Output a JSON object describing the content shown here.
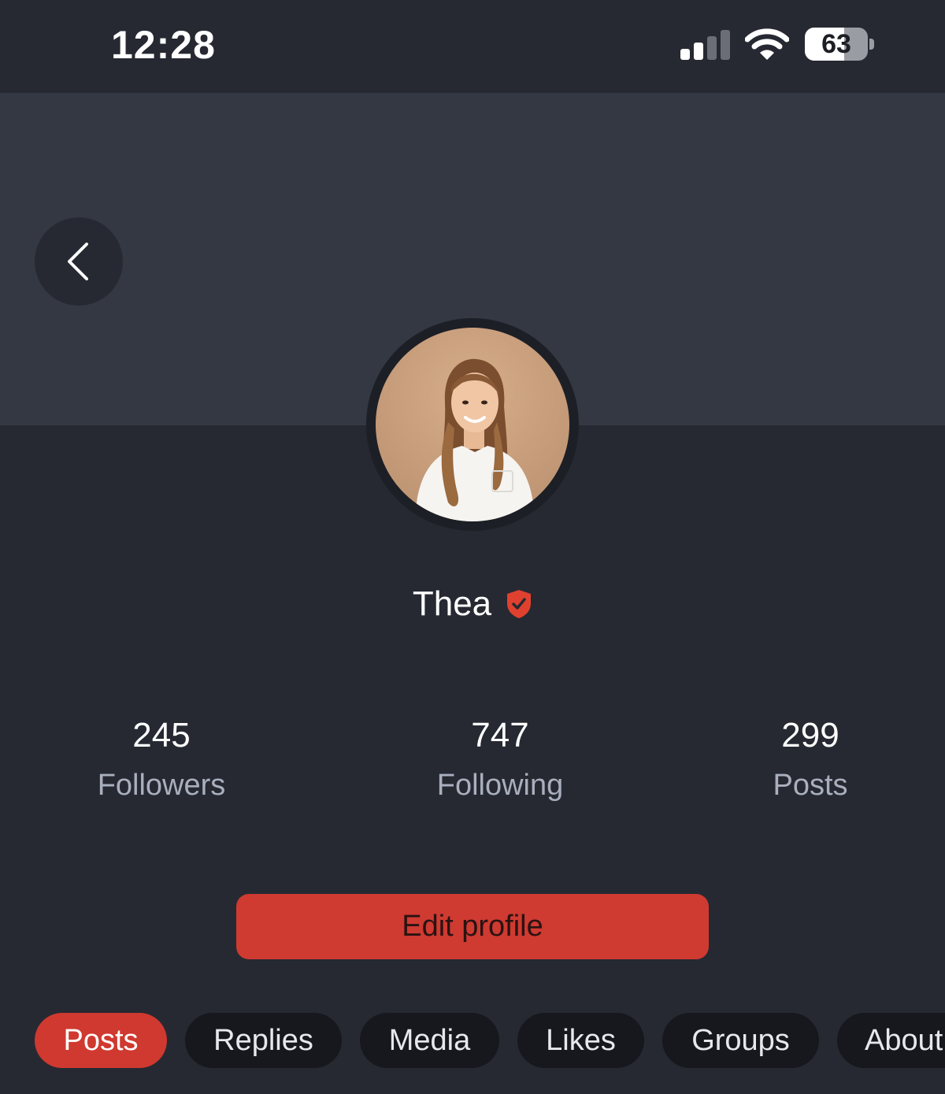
{
  "status_bar": {
    "time": "12:28",
    "battery_level": "63",
    "battery_fraction": 0.63,
    "signal_bars_active": 2,
    "signal_bars_total": 4
  },
  "colors": {
    "background": "#262932",
    "cover": "#343842",
    "accent": "#cf3a31",
    "muted_text": "#a9afbd",
    "tab_background": "#17181d"
  },
  "profile": {
    "name": "Thea",
    "verified": true,
    "verified_icon": "verified-shield-icon"
  },
  "stats": [
    {
      "value": "245",
      "label": "Followers"
    },
    {
      "value": "747",
      "label": "Following"
    },
    {
      "value": "299",
      "label": "Posts"
    }
  ],
  "actions": {
    "edit_profile_label": "Edit profile"
  },
  "tabs": [
    {
      "label": "Posts",
      "active": true
    },
    {
      "label": "Replies",
      "active": false
    },
    {
      "label": "Media",
      "active": false
    },
    {
      "label": "Likes",
      "active": false
    },
    {
      "label": "Groups",
      "active": false
    },
    {
      "label": "About",
      "active": false
    }
  ]
}
